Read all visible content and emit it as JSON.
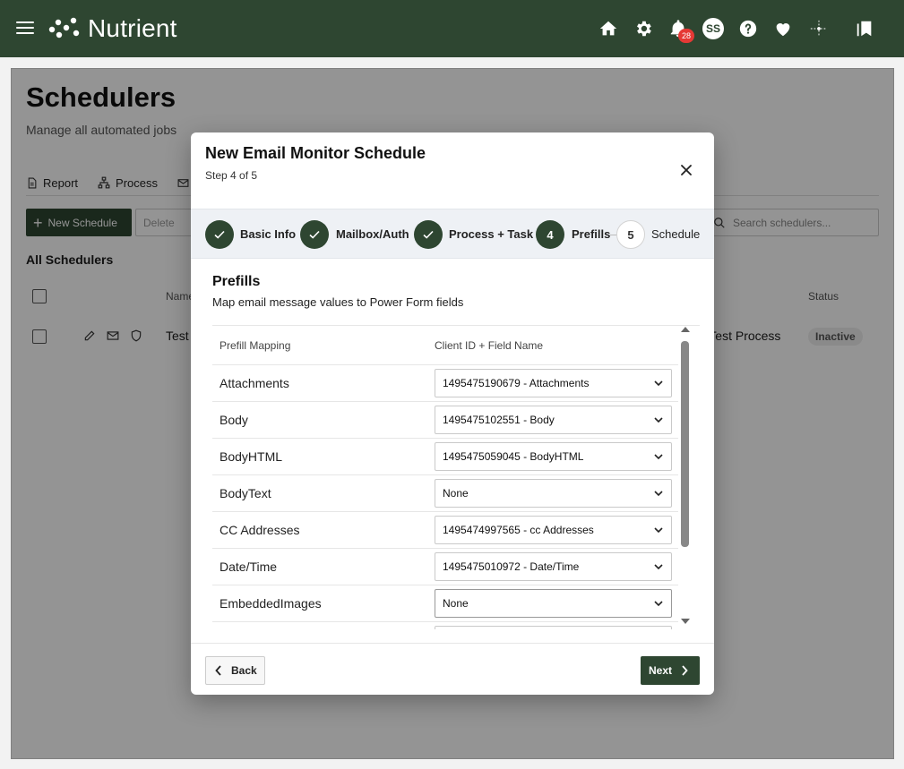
{
  "app": {
    "logo_text": "Nutrient",
    "notification_count": "28",
    "avatar_initials": "SS"
  },
  "icons": [
    "menu-icon",
    "home-icon",
    "gear-icon",
    "bell-icon",
    "help-icon",
    "heart-icon",
    "sparkle-icon",
    "bookmark-icon"
  ],
  "colors": {
    "brand": "#2e4631",
    "badge": "#e53935"
  },
  "page": {
    "title": "Schedulers",
    "subtitle": "Manage all automated jobs",
    "tabs": [
      {
        "label": "Report"
      },
      {
        "label": "Process"
      }
    ],
    "new_button": "New Schedule",
    "delete_button": "Delete",
    "search_placeholder": "Search schedulers...",
    "section_label": "All Schedulers",
    "columns": {
      "name": "Name",
      "status": "Status"
    },
    "row": {
      "name": "Test",
      "process": "r Test Process",
      "status": "Inactive"
    }
  },
  "modal": {
    "title": "New Email Monitor Schedule",
    "step_text": "Step 4 of 5",
    "steps": [
      {
        "number": "1",
        "label": "Basic Info",
        "state": "done"
      },
      {
        "number": "2",
        "label": "Mailbox/Auth",
        "state": "done"
      },
      {
        "number": "3",
        "label": "Process + Task",
        "state": "done"
      },
      {
        "number": "4",
        "label": "Prefills",
        "state": "active"
      },
      {
        "number": "5",
        "label": "Schedule",
        "state": "todo"
      }
    ],
    "section_title": "Prefills",
    "section_subtitle": "Map email message values to Power Form fields",
    "table": {
      "col1": "Prefill Mapping",
      "col2": "Client ID + Field Name",
      "rows": [
        {
          "label": "Attachments",
          "value": "1495475190679 - Attachments"
        },
        {
          "label": "Body",
          "value": "1495475102551 - Body"
        },
        {
          "label": "BodyHTML",
          "value": "1495475059045 - BodyHTML"
        },
        {
          "label": "BodyText",
          "value": "None"
        },
        {
          "label": "CC Addresses",
          "value": "1495474997565 - cc Addresses"
        },
        {
          "label": "Date/Time",
          "value": "1495475010972 - Date/Time"
        },
        {
          "label": "EmbeddedImages",
          "value": "None"
        }
      ]
    },
    "back_button": "Back",
    "next_button": "Next"
  }
}
